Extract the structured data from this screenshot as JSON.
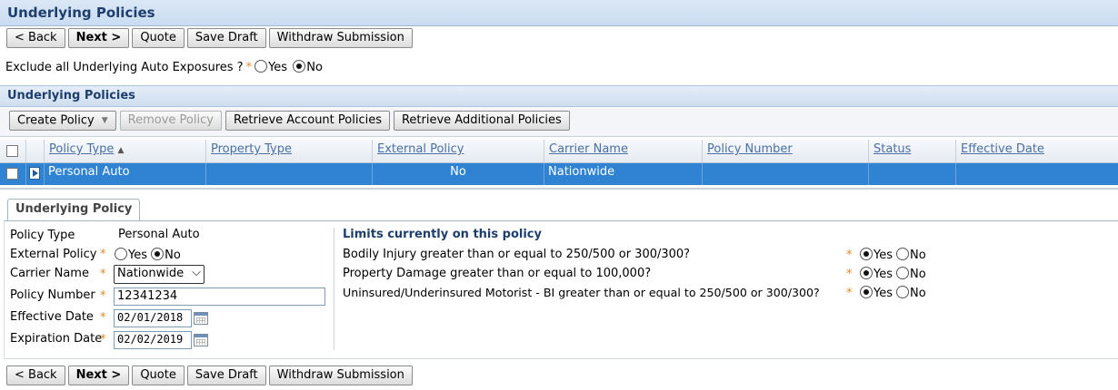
{
  "page": {
    "title": "Underlying Policies"
  },
  "toolbar": {
    "back": "< Back",
    "next": "Next >",
    "quote": "Quote",
    "save_draft": "Save Draft",
    "withdraw": "Withdraw Submission"
  },
  "exclude": {
    "question": "Exclude all Underlying Auto Exposures ?",
    "yes": "Yes",
    "no": "No",
    "selected": "No"
  },
  "section": {
    "title": "Underlying Policies"
  },
  "list_toolbar": {
    "create_policy": "Create Policy",
    "remove_policy": "Remove Policy",
    "retrieve_account": "Retrieve Account Policies",
    "retrieve_additional": "Retrieve Additional Policies"
  },
  "grid": {
    "columns": [
      "Policy Type",
      "Property Type",
      "External Policy",
      "Carrier Name",
      "Policy Number",
      "Status",
      "Effective Date"
    ],
    "sort_indicator": "▲",
    "rows": [
      {
        "policy_type": "Personal Auto",
        "property_type": "",
        "external_policy": "No",
        "carrier_name": "Nationwide",
        "policy_number": "",
        "status": "",
        "effective_date": ""
      }
    ]
  },
  "detail": {
    "tab": "Underlying Policy",
    "policy_type_label": "Policy Type",
    "policy_type_value": "Personal Auto",
    "external_policy_label": "External Policy",
    "external_yes": "Yes",
    "external_no": "No",
    "carrier_label": "Carrier Name",
    "carrier_value": "Nationwide",
    "policy_number_label": "Policy Number",
    "policy_number_value": "12341234",
    "effective_label": "Effective Date",
    "effective_value": "02/01/2018",
    "expiration_label": "Expiration Date",
    "expiration_value": "02/02/2019"
  },
  "limits": {
    "title": "Limits currently on this policy",
    "questions": [
      "Bodily Injury greater than or equal to 250/500 or 300/300?",
      "Property Damage greater than or equal to 100,000?",
      "Uninsured/Underinsured Motorist - BI greater than or equal to 250/500 or 300/300?"
    ],
    "yes": "Yes",
    "no": "No"
  },
  "colors": {
    "accent": "#2f83d2",
    "header_text": "#1e3f6e",
    "required": "#e08a2e",
    "link": "#4a70a6"
  },
  "icons": {
    "calendar": "calendar-icon",
    "expander": "row-expander-icon",
    "sort": "sort-ascending-icon"
  }
}
